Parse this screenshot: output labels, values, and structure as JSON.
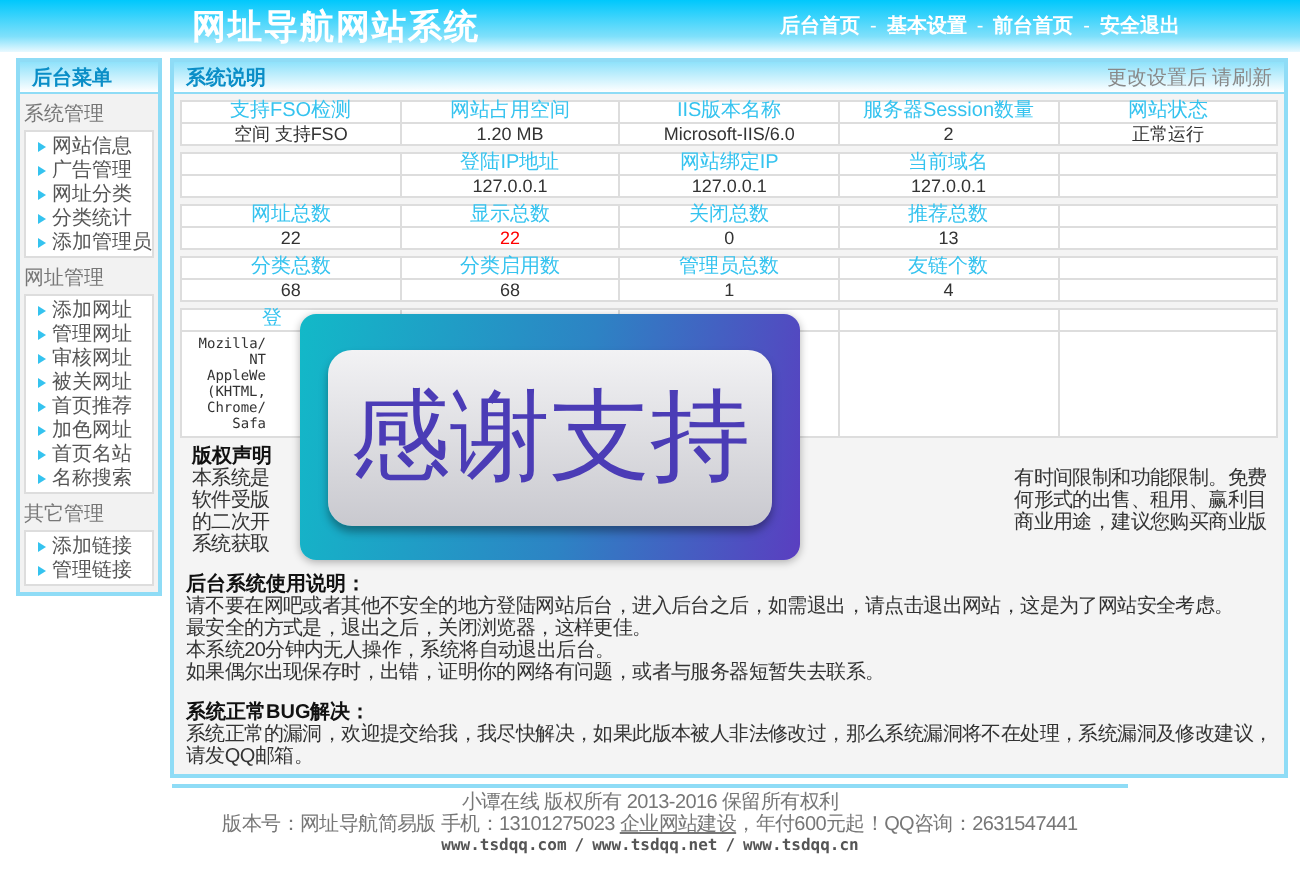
{
  "header": {
    "title": "网址导航网站系统",
    "nav": [
      "后台首页",
      "基本设置",
      "前台首页",
      "安全退出"
    ],
    "separator": "-"
  },
  "sidebar": {
    "title": "后台菜单",
    "groups": [
      {
        "title": "系统管理",
        "items": [
          "网站信息",
          "广告管理",
          "网址分类",
          "分类统计",
          "添加管理员"
        ]
      },
      {
        "title": "网址管理",
        "items": [
          "添加网址",
          "管理网址",
          "审核网址",
          "被关网址",
          "首页推荐",
          "加色网址",
          "首页名站",
          "名称搜索"
        ]
      },
      {
        "title": "其它管理",
        "items": [
          "添加链接",
          "管理链接"
        ]
      }
    ]
  },
  "panel": {
    "title": "系统说明",
    "hint": "更改设置后 请刷新",
    "stat_tables": [
      {
        "cells": [
          {
            "label": "支持FSO检测",
            "value": "空间 支持FSO"
          },
          {
            "label": "网站占用空间",
            "value": "1.20 MB"
          },
          {
            "label": "IIS版本名称",
            "value": "Microsoft-IIS/6.0"
          },
          {
            "label": "服务器Session数量",
            "value": "2"
          },
          {
            "label": "网站状态",
            "value": "正常运行"
          }
        ]
      },
      {
        "cells": [
          {},
          {
            "label": "登陆IP地址",
            "value": "127.0.0.1"
          },
          {
            "label": "网站绑定IP",
            "value": "127.0.0.1"
          },
          {
            "label": "当前域名",
            "value": "127.0.0.1"
          },
          {}
        ]
      },
      {
        "cells": [
          {
            "label": "网址总数",
            "value": "22"
          },
          {
            "label": "显示总数",
            "value": "22",
            "color": "#ff0000"
          },
          {
            "label": "关闭总数",
            "value": "0"
          },
          {
            "label": "推荐总数",
            "value": "13"
          },
          {}
        ]
      },
      {
        "cells": [
          {
            "label": "分类总数",
            "value": "68"
          },
          {
            "label": "分类启用数",
            "value": "68"
          },
          {
            "label": "管理员总数",
            "value": "1"
          },
          {
            "label": "友链个数",
            "value": "4"
          },
          {}
        ]
      }
    ],
    "agent_table": {
      "column_1": "登",
      "agent_lines": [
        "Mozilla/",
        "NT",
        "AppleWe",
        "(KHTML,",
        "Chrome/",
        "Safa"
      ]
    },
    "copyright": {
      "title": "版权声明",
      "lines": [
        {
          "left": "本系统是",
          "right": "有时间限制和功能限制。免费"
        },
        {
          "left": "软件受版",
          "right": "何形式的出售、租用、赢利目"
        },
        {
          "left": "的二次开",
          "right": "商业用途，建议您购买商业版"
        },
        {
          "left": "系统获取"
        }
      ]
    },
    "promo": {
      "text": "感谢支持"
    },
    "sections": [
      {
        "title": "后台系统使用说明：",
        "lines": [
          "请不要在网吧或者其他不安全的地方登陆网站后台，进入后台之后，如需退出，请点击退出网站，这是为了网站安全考虑。",
          "最安全的方式是，退出之后，关闭浏览器，这样更佳。",
          "本系统20分钟内无人操作，系统将自动退出后台。",
          "如果偶尔出现保存时，出错，证明你的网络有问题，或者与服务器短暂失去联系。"
        ]
      },
      {
        "title": "系统正常BUG解决：",
        "lines": [
          "系统正常的漏洞，欢迎提交给我，我尽快解决，如果此版本被人非法修改过，那么系统漏洞将不在处理，系统漏洞及修改建议，",
          "请发QQ邮箱。"
        ]
      }
    ]
  },
  "footer": {
    "line_1": "小谭在线 版权所有 2013-2016 保留所有权利",
    "line_2_before": "版本号：网址导航简易版 手机：13101275023",
    "link": "企业网站建设",
    "line_2_after": "，年付600元起！QQ咨询：2631547441",
    "sites": [
      "www.tsdqq.com",
      "www.tsdqq.net",
      "www.tsdqq.cn"
    ],
    "sites_separator": "/"
  }
}
